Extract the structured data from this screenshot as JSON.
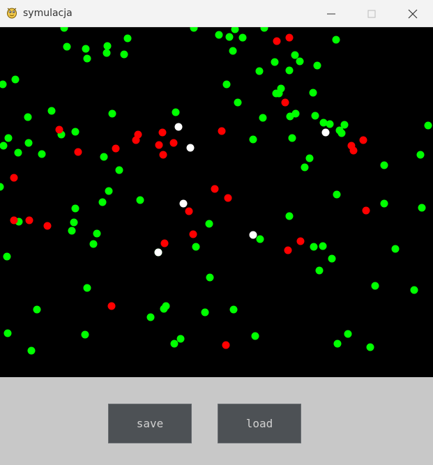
{
  "window": {
    "title": "symulacja",
    "icon": "python-snake-icon"
  },
  "controls": {
    "save_label": "save",
    "load_label": "load"
  },
  "colors": {
    "healthy": "#00ff00",
    "infected": "#ff0000",
    "recovered": "#ffffff",
    "canvas_background": "#000000",
    "panel_background": "#c8c8c8",
    "button_background": "#4d5155"
  },
  "counts": {
    "healthy": 130,
    "infected": 32,
    "recovered": 7
  }
}
